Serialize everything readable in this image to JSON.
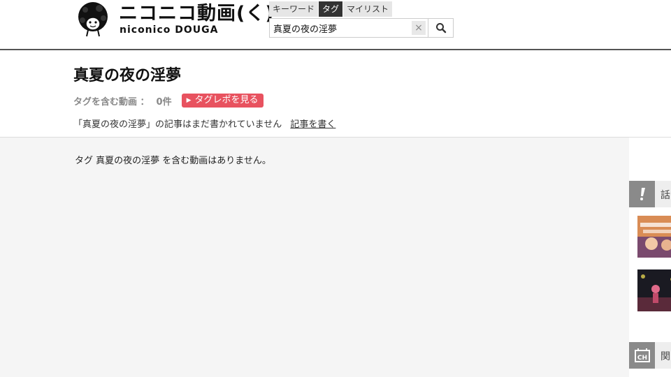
{
  "header": {
    "logo": {
      "main_text": "ニコニコ動画(く)",
      "sub_text": "niconico DOUGA"
    },
    "search": {
      "tabs": [
        {
          "label": "キーワード",
          "active": false
        },
        {
          "label": "タグ",
          "active": true
        },
        {
          "label": "マイリスト",
          "active": false
        }
      ],
      "value": "真夏の夜の淫夢",
      "clear_label": "×"
    }
  },
  "title_area": {
    "title": "真夏の夜の淫夢",
    "count_label": "タグを含む動画 ：",
    "count_value": "0件",
    "tagrepo_label": "タグレポを見る",
    "article_message": "「真夏の夜の淫夢」の記事はまだ書かれていません",
    "article_link": "記事を書く"
  },
  "content": {
    "empty_message": "タグ 真夏の夜の淫夢 を含む動画はありません。"
  },
  "sidebar": {
    "sections": [
      {
        "label": "話",
        "icon": "exclamation-icon"
      },
      {
        "label": "関",
        "icon": "dic-icon"
      }
    ]
  },
  "colors": {
    "accent": "#e8525f",
    "active_tab": "#333333",
    "sidebar_icon_bg": "#8a8a8a",
    "content_bg": "#f5f5f5"
  }
}
